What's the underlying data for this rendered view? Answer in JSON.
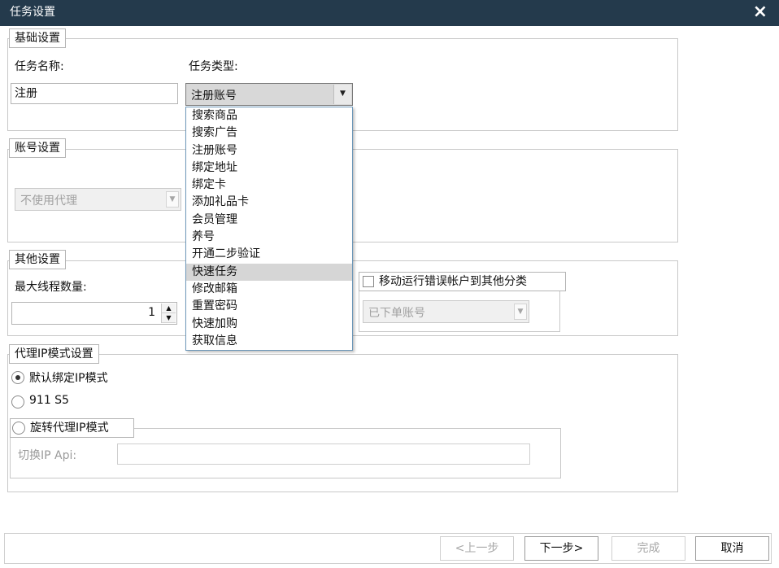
{
  "window": {
    "title": "任务设置",
    "close_glyph": "×"
  },
  "basic": {
    "legend": "基础设置",
    "task_name_label": "任务名称:",
    "task_name_value": "注册",
    "task_type_label": "任务类型:",
    "task_type_value": "注册账号",
    "task_type_options": [
      "搜索商品",
      "搜索广告",
      "注册账号",
      "绑定地址",
      "绑定卡",
      "添加礼品卡",
      "会员管理",
      "养号",
      "开通二步验证",
      "快速任务",
      "修改邮箱",
      "重置密码",
      "快速加购",
      "获取信息"
    ],
    "highlighted_option": "快速任务"
  },
  "account": {
    "legend": "账号设置",
    "proxy_value": "不使用代理"
  },
  "other": {
    "legend": "其他设置",
    "max_threads_label": "最大线程数量:",
    "max_threads_value": "1",
    "move_error_label": "移动运行错误帐户到其他分类",
    "move_error_checked": false,
    "category_value": "已下单账号"
  },
  "proxy_mode": {
    "legend": "代理IP模式设置",
    "options": [
      "默认绑定IP模式",
      "911 S5",
      "旋转代理IP模式"
    ],
    "selected_index": 0,
    "switch_api_label": "切换IP Api:",
    "switch_api_value": ""
  },
  "footer": {
    "prev": "<上一步",
    "next": "下一步>",
    "finish": "完成",
    "cancel": "取消"
  }
}
